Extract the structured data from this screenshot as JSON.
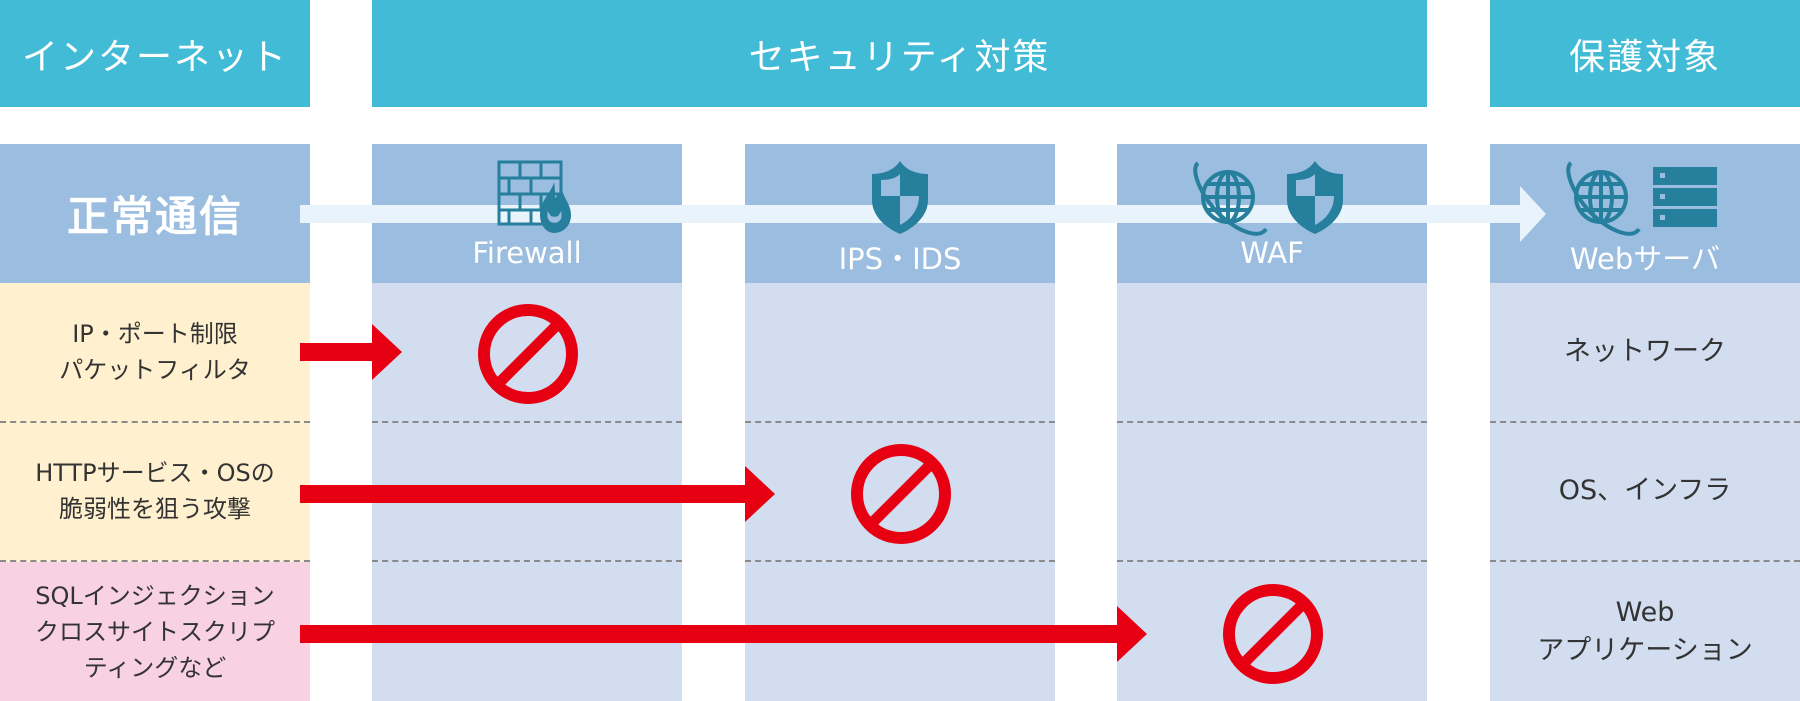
{
  "headers": {
    "internet": "インターネット",
    "security": "セキュリティ対策",
    "protected": "保護対象"
  },
  "normal_traffic": {
    "label": "正常通信"
  },
  "defenses": [
    {
      "label": "Firewall",
      "icon": "firewall-icon"
    },
    {
      "label": "IPS・IDS",
      "icon": "shield-icon"
    },
    {
      "label": "WAF",
      "icon": "globe-shield-icon"
    }
  ],
  "target": {
    "label": "Webサーバ",
    "icon": "globe-server-icon"
  },
  "attacks": [
    {
      "label": "IP・ポート制限\nパケットフィルタ",
      "blocked_by": "Firewall",
      "protects": "ネットワーク"
    },
    {
      "label": "HTTPサービス・OSの\n脆弱性を狙う攻撃",
      "blocked_by": "IPS・IDS",
      "protects": "OS、インフラ"
    },
    {
      "label": "SQLインジェクション\nクロスサイトスクリプ\nティングなど",
      "blocked_by": "WAF",
      "protects": "Web\nアプリケーション"
    }
  ],
  "colors": {
    "header": "#42bbd6",
    "subheader": "#9abde0",
    "body": "#d2def0",
    "attack_yellow": "#fff0cf",
    "attack_pink": "#f8d1e3",
    "block_red": "#e60012",
    "icon_teal": "#267f9c",
    "flow_arrow": "#e8f3fb"
  }
}
